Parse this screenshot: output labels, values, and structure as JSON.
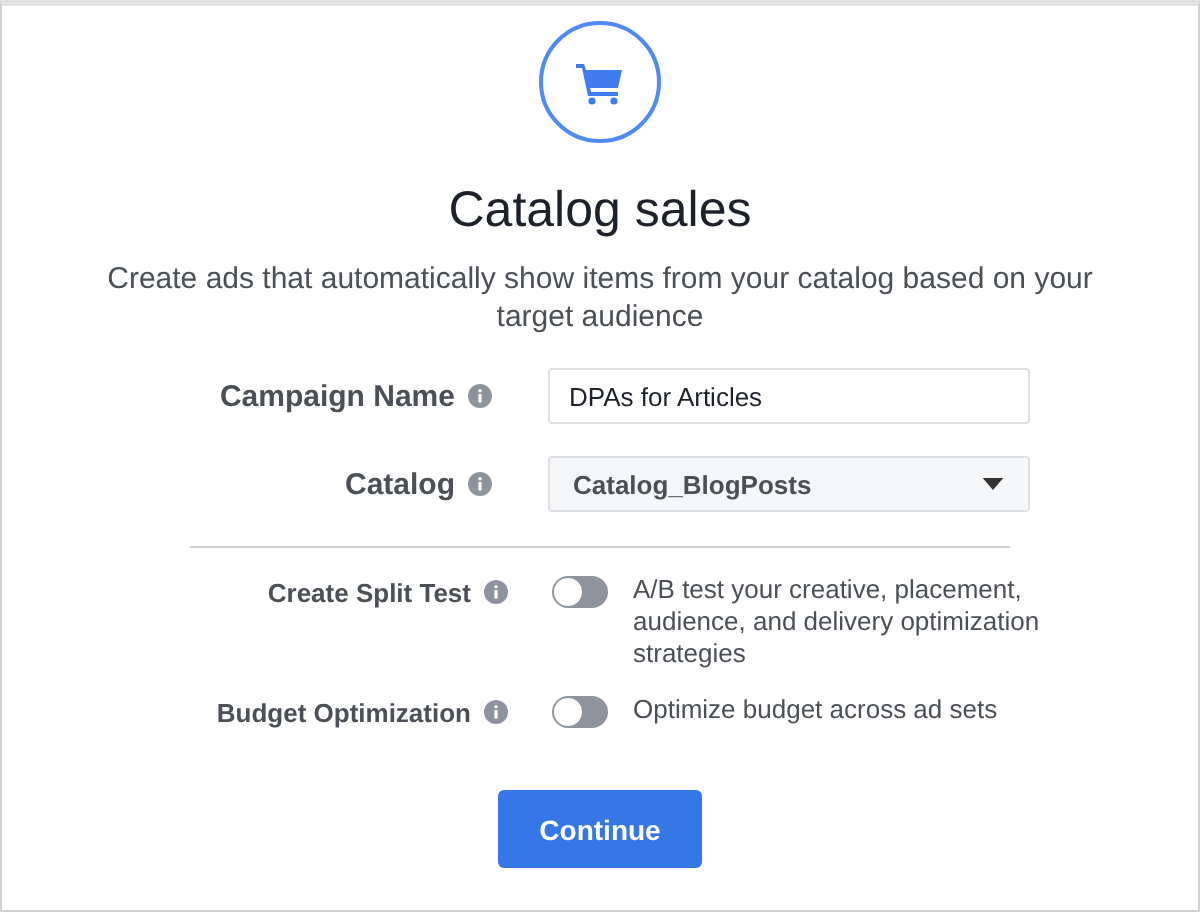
{
  "title": "Catalog sales",
  "subtitle": "Create ads that automatically show items from your catalog based on your target audience",
  "fields": [
    {
      "label": "Campaign Name",
      "kind": "text",
      "value": "DPAs for Articles"
    },
    {
      "label": "Catalog",
      "kind": "dropdown",
      "value": "Catalog_BlogPosts"
    }
  ],
  "toggles": [
    {
      "label": "Create Split Test",
      "on": false,
      "description": "A/B test your creative, placement, audience, and delivery optimization strategies"
    },
    {
      "label": "Budget Optimization",
      "on": false,
      "description": "Optimize budget across ad sets"
    }
  ],
  "button": "Continue"
}
